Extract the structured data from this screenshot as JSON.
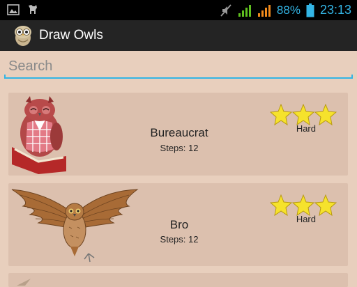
{
  "status_bar": {
    "battery": "88%",
    "time": "23:13",
    "icons": [
      "image-notification-icon",
      "cat-notification-icon",
      "mute-icon",
      "signal-green-icon",
      "signal-orange-icon",
      "battery-icon"
    ]
  },
  "action_bar": {
    "title": "Draw Owls",
    "icon": "owl-app-icon"
  },
  "search": {
    "placeholder": "Search",
    "value": ""
  },
  "owls": [
    {
      "name": "Bureaucrat",
      "steps": "Steps: 12",
      "difficulty": "Hard",
      "stars": 3
    },
    {
      "name": "Bro",
      "steps": "Steps: 12",
      "difficulty": "Hard",
      "stars": 3
    }
  ],
  "colors": {
    "background": "#e8cfbd",
    "card": "#dcc0ae",
    "accent": "#33b5e5",
    "action_bar": "#242424"
  }
}
